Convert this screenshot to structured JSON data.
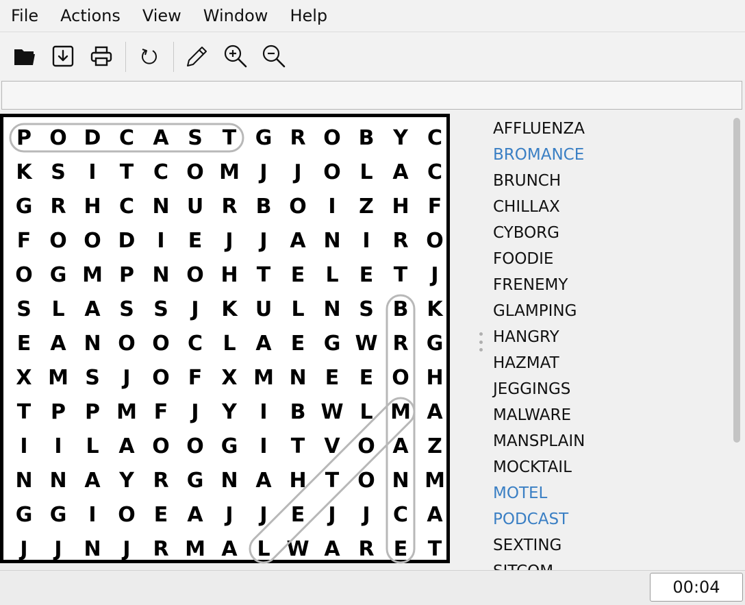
{
  "menu": [
    "File",
    "Actions",
    "View",
    "Window",
    "Help"
  ],
  "toolbar": {
    "icons": [
      "folder-open-icon",
      "save-icon",
      "print-icon",
      "refresh-icon",
      "pencil-icon",
      "zoom-in-icon",
      "zoom-out-icon"
    ]
  },
  "clue_field": {
    "value": ""
  },
  "grid": {
    "rows": [
      "PODCASTGROBYC",
      "KSITCOMJJOLAC",
      "GRHCNURBOIZHF",
      "FOODIEJJANIRO",
      "OGMPNOHTELETJ",
      "SLASSJKULNSBK",
      "EANOOCLAEGWRG",
      "XMSJOFXMNEEOH",
      "TPPMFJYIBWLMA",
      "IILAOOGITVOAZ",
      "NNAYRGNAHTONM",
      "GGIOEAJJEJJCA",
      "JJNJRMALWARET"
    ],
    "found": [
      {
        "word": "PODCAST",
        "start": [
          0,
          0
        ],
        "end": [
          0,
          6
        ]
      },
      {
        "word": "BROMANCE",
        "start": [
          5,
          11
        ],
        "end": [
          12,
          11
        ]
      },
      {
        "word": "MALWARE",
        "start": [
          8,
          11
        ],
        "end": [
          12,
          7
        ]
      }
    ]
  },
  "words": [
    {
      "text": "AFFLUENZA",
      "found": false
    },
    {
      "text": "BROMANCE",
      "found": true
    },
    {
      "text": "BRUNCH",
      "found": false
    },
    {
      "text": "CHILLAX",
      "found": false
    },
    {
      "text": "CYBORG",
      "found": false
    },
    {
      "text": "FOODIE",
      "found": false
    },
    {
      "text": "FRENEMY",
      "found": false
    },
    {
      "text": "GLAMPING",
      "found": false
    },
    {
      "text": "HANGRY",
      "found": false
    },
    {
      "text": "HAZMAT",
      "found": false
    },
    {
      "text": "JEGGINGS",
      "found": false
    },
    {
      "text": "MALWARE",
      "found": false
    },
    {
      "text": "MANSPLAIN",
      "found": false
    },
    {
      "text": "MOCKTAIL",
      "found": false
    },
    {
      "text": "MOTEL",
      "found": true
    },
    {
      "text": "PODCAST",
      "found": true
    },
    {
      "text": "SEXTING",
      "found": false
    },
    {
      "text": "SITCOM",
      "found": false
    }
  ],
  "found_color": "#3a7fc4",
  "timer": "00:04"
}
